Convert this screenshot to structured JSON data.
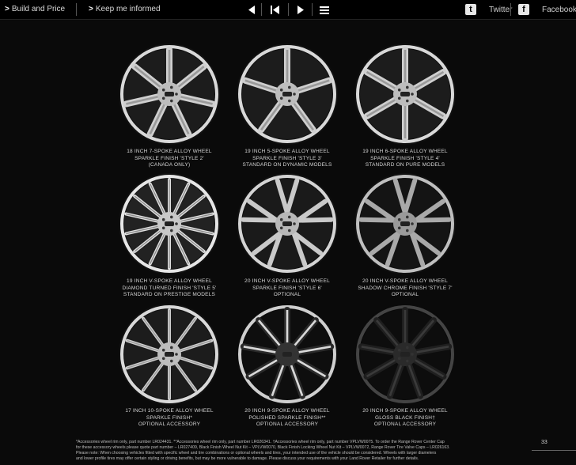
{
  "topbar": {
    "build_label": "Build and Price",
    "keep_label": "Keep me informed",
    "twitter_label": "Twitter",
    "facebook_label": "Facebook",
    "twitter_icon": "t",
    "facebook_icon": "f",
    "arrow_glyph": ">"
  },
  "wheels": [
    {
      "line1": "18 INCH 7-SPOKE ALLOY WHEEL",
      "line2": "SPARKLE FINISH 'STYLE 2'",
      "line3": "(CANADA ONLY)",
      "spokes": 7,
      "finish": "sparkle"
    },
    {
      "line1": "19 INCH 5-SPOKE ALLOY WHEEL",
      "line2": "SPARKLE FINISH 'STYLE 3'",
      "line3": "STANDARD ON DYNAMIC MODELS",
      "spokes": 5,
      "finish": "sparkle"
    },
    {
      "line1": "19 INCH 6-SPOKE ALLOY WHEEL",
      "line2": "SPARKLE FINISH 'STYLE 4'",
      "line3": "STANDARD ON PURE MODELS",
      "spokes": 6,
      "finish": "sparkle"
    },
    {
      "line1": "19 INCH V-SPOKE ALLOY WHEEL",
      "line2": "DIAMOND TURNED FINISH 'STYLE 5'",
      "line3": "STANDARD ON PRESTIGE MODELS",
      "spokes": 14,
      "finish": "diamond"
    },
    {
      "line1": "20 INCH V-SPOKE ALLOY WHEEL",
      "line2": "SPARKLE FINISH 'STYLE 6'",
      "line3": "OPTIONAL",
      "spokes": 5,
      "finish": "vspoke"
    },
    {
      "line1": "20 INCH V-SPOKE ALLOY WHEEL",
      "line2": "SHADOW CHROME FINISH 'STYLE 7'",
      "line3": "OPTIONAL",
      "spokes": 5,
      "finish": "vspoke-dark"
    },
    {
      "line1": "17 INCH 10-SPOKE ALLOY WHEEL",
      "line2": "SPARKLE FINISH*",
      "line3": "OPTIONAL ACCESSORY",
      "spokes": 10,
      "finish": "sparkle"
    },
    {
      "line1": "20 INCH 9-SPOKE ALLOY WHEEL",
      "line2": "POLISHED SPARKLE FINISH**",
      "line3": "OPTIONAL ACCESSORY",
      "spokes": 9,
      "finish": "polished-black"
    },
    {
      "line1": "20 INCH 9-SPOKE ALLOY WHEEL",
      "line2": "GLOSS BLACK FINISH†",
      "line3": "OPTIONAL ACCESSORY",
      "spokes": 9,
      "finish": "gloss-black"
    }
  ],
  "footer": {
    "line1": "*Accessories wheel rim only, part number LR024431. **Accessories wheel rim only, part number LR026341. †Accessories wheel rim only, part number VPLVW0075. To order the Range Rover Center Cap",
    "line2": "for these accessory wheels please quote part number – LR027409, Black Finish Wheel Nut Kit – VPLVW0070, Black Finish Locking Wheel Nut Kit – VPLVW0072, Range Rover Tire Valve Caps – LR026163.",
    "line3": "Please note: When choosing vehicles fitted with specific wheel and tire combinations or optional wheels and tires, your intended use of the vehicle should be considered. Wheels with larger diameters",
    "line4": "and lower profile tires may offer certain styling or driving benefits, but may be more vulnerable to damage. Please discuss your requirements with your Land Rover Retailer for further details.",
    "page_number": "33"
  }
}
